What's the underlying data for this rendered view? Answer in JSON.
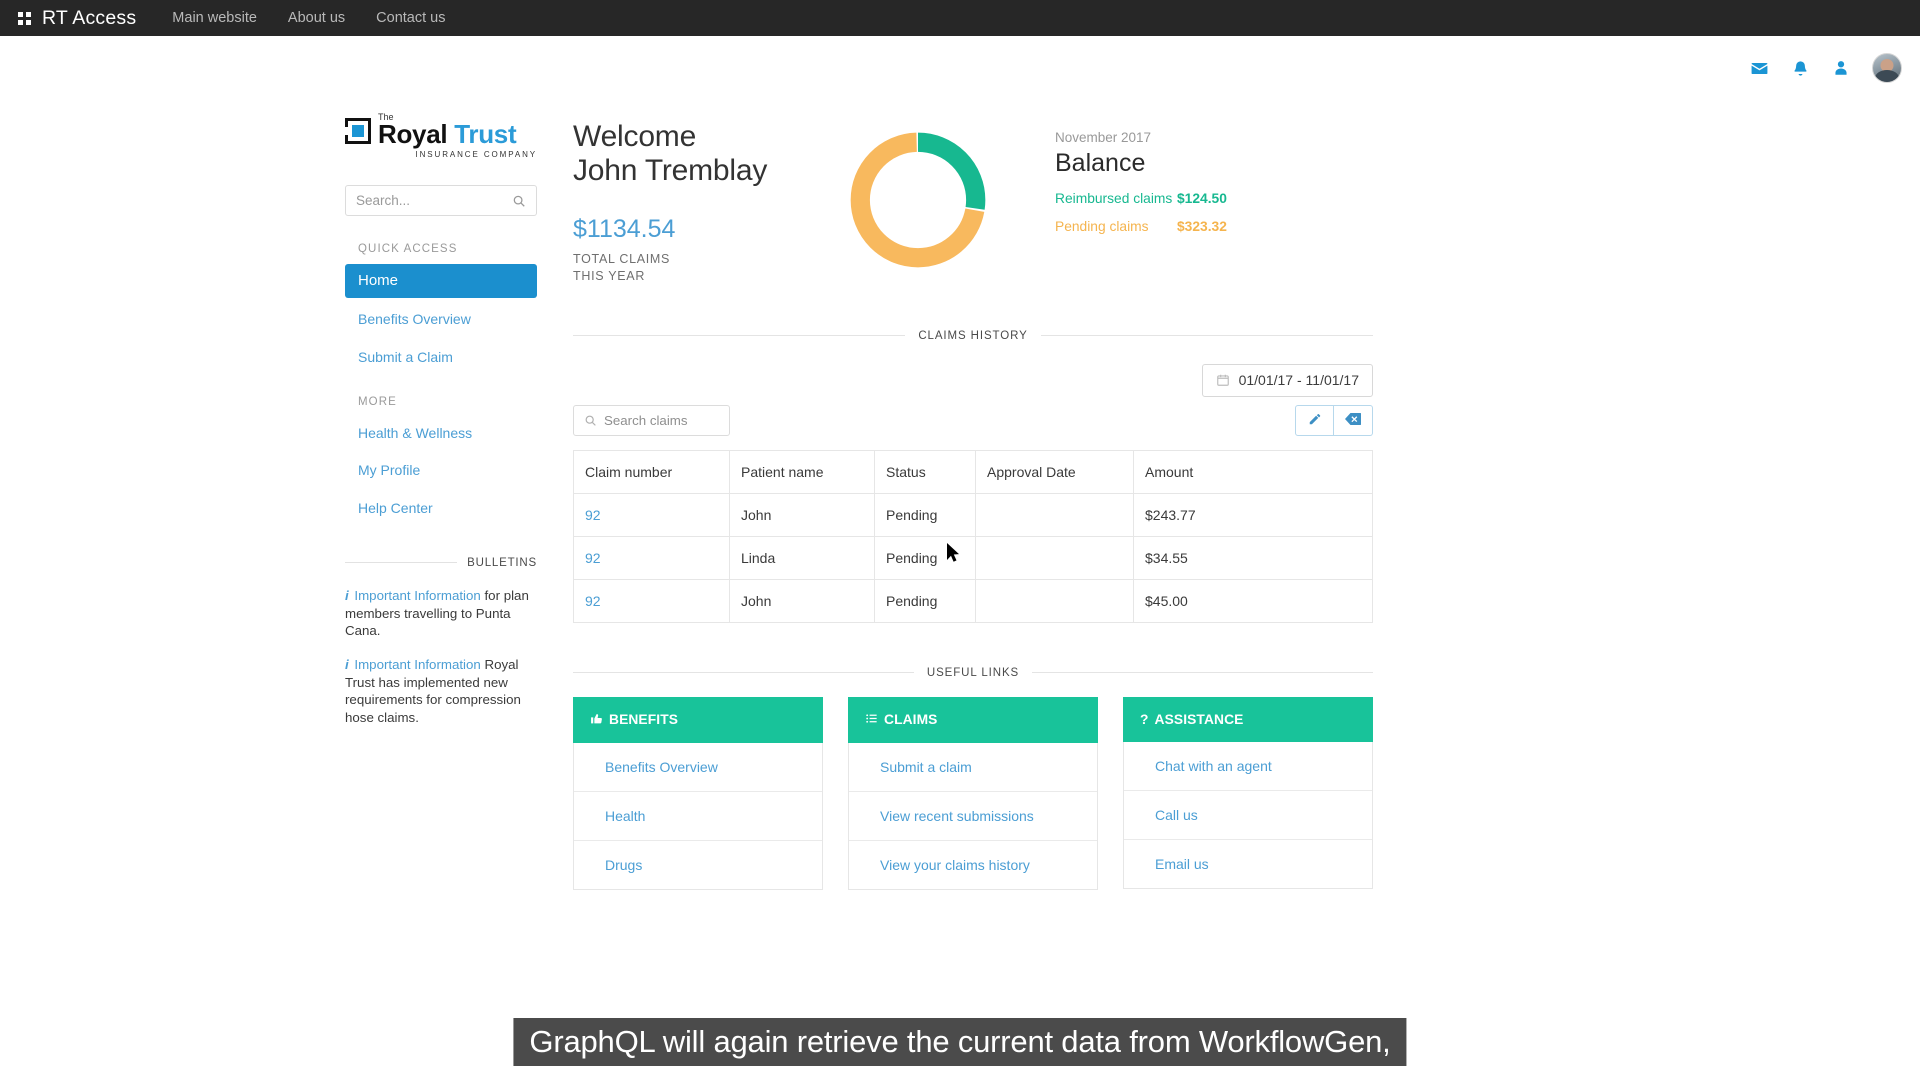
{
  "topbar": {
    "brand_prefix": "RT ",
    "brand_main": "Access",
    "grid_icon": "grid-icon",
    "nav": [
      {
        "label": "Main website"
      },
      {
        "label": "About us"
      },
      {
        "label": "Contact us"
      }
    ]
  },
  "header_icons": [
    {
      "name": "mail-icon",
      "glyph": "envelope"
    },
    {
      "name": "notifications-icon",
      "glyph": "bell"
    },
    {
      "name": "user-icon",
      "glyph": "person"
    },
    {
      "name": "avatar",
      "glyph": "photo"
    }
  ],
  "logo": {
    "the": "The",
    "royal": "Royal",
    "trust": "Trust",
    "subtitle": "INSURANCE COMPANY",
    "mark_color": "#1b95d4"
  },
  "search": {
    "placeholder": "Search...",
    "value": "",
    "icon": "search-icon"
  },
  "sidebar": {
    "quick_access_label": "QUICK ACCESS",
    "more_label": "MORE",
    "quick_access": [
      {
        "label": "Home",
        "active": true
      },
      {
        "label": "Benefits Overview",
        "active": false
      },
      {
        "label": "Submit a Claim",
        "active": false
      }
    ],
    "more": [
      {
        "label": "Health & Wellness"
      },
      {
        "label": "My Profile"
      },
      {
        "label": "Help Center"
      }
    ],
    "bulletins_label": "BULLETINS",
    "bulletins": [
      {
        "link": "Important Information",
        "rest": " for plan members travelling to Punta Cana."
      },
      {
        "link": "Important Information",
        "rest": " Royal Trust has implemented new requirements for compression hose claims."
      }
    ]
  },
  "welcome": {
    "greeting": "Welcome",
    "name": "John Tremblay",
    "total": "$1134.54",
    "total_label_line1": "TOTAL CLAIMS",
    "total_label_line2": "THIS YEAR"
  },
  "balance": {
    "date": "November 2017",
    "title": "Balance",
    "reimbursed_label": "Reimbursed claims",
    "reimbursed_value": "$124.50",
    "pending_label": "Pending claims",
    "pending_value": "$323.32"
  },
  "chart_data": {
    "type": "pie",
    "title": "Balance",
    "subtitle": "November 2017",
    "categories": [
      "Reimbursed claims",
      "Pending claims"
    ],
    "values": [
      124.5,
      323.32
    ],
    "value_labels": [
      "$124.50",
      "$323.32"
    ],
    "colors": [
      "#17b890",
      "#f8b95e"
    ],
    "donut": true,
    "inner_radius_ratio": 0.72,
    "start_angle_deg": 0,
    "legend": "right"
  },
  "claims": {
    "section_label": "CLAIMS HISTORY",
    "date_range": "01/01/17 - 11/01/17",
    "calendar_icon": "calendar-icon",
    "search_placeholder": "Search claims",
    "search_value": "",
    "buttons": [
      {
        "name": "edit-button",
        "icon": "pencil-icon"
      },
      {
        "name": "delete-button",
        "icon": "backspace-icon"
      }
    ],
    "columns": [
      "Claim number",
      "Patient name",
      "Status",
      "Approval Date",
      "Amount"
    ],
    "rows": [
      {
        "claim_number": "92",
        "patient_name": "John",
        "status": "Pending",
        "approval_date": "",
        "amount": "$243.77"
      },
      {
        "claim_number": "92",
        "patient_name": "Linda",
        "status": "Pending",
        "approval_date": "",
        "amount": "$34.55"
      },
      {
        "claim_number": "92",
        "patient_name": "John",
        "status": "Pending",
        "approval_date": "",
        "amount": "$45.00"
      }
    ]
  },
  "useful_links": {
    "section_label": "USEFUL LINKS",
    "cards": [
      {
        "title": "BENEFITS",
        "icon": "thumbs-up-icon",
        "links": [
          {
            "label": "Benefits Overview"
          },
          {
            "label": "Health"
          },
          {
            "label": "Drugs"
          }
        ]
      },
      {
        "title": "CLAIMS",
        "icon": "list-icon",
        "links": [
          {
            "label": "Submit a claim"
          },
          {
            "label": "View recent submissions"
          },
          {
            "label": "View your claims history"
          }
        ]
      },
      {
        "title": "ASSISTANCE",
        "icon": "question-mark-icon",
        "links": [
          {
            "label": "Chat with an agent"
          },
          {
            "label": "Call us"
          },
          {
            "label": "Email us"
          }
        ]
      }
    ]
  },
  "caption": {
    "text": "GraphQL will again retrieve the current data from WorkflowGen,"
  },
  "colors": {
    "accent_blue": "#1b8fce",
    "link_blue": "#4b9ed4",
    "green": "#17b890",
    "orange": "#f5b44e",
    "card_green": "#18c39a"
  }
}
